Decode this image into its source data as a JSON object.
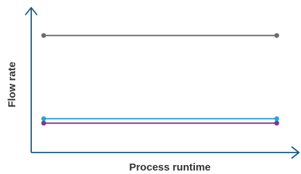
{
  "chart_data": {
    "type": "line",
    "xlabel": "Process runtime",
    "ylabel": "Flow rate",
    "x": [
      0,
      1
    ],
    "ylim": [
      0,
      1
    ],
    "axis_color": "#0e5a86",
    "grid": false,
    "legend": "none",
    "series": [
      {
        "color": "#6e6e6e",
        "values": [
          0.93,
          0.93
        ]
      },
      {
        "color": "#2aa6d6",
        "values": [
          0.18,
          0.18
        ]
      },
      {
        "color": "#7a3b8c",
        "values": [
          0.14,
          0.14
        ]
      }
    ]
  }
}
